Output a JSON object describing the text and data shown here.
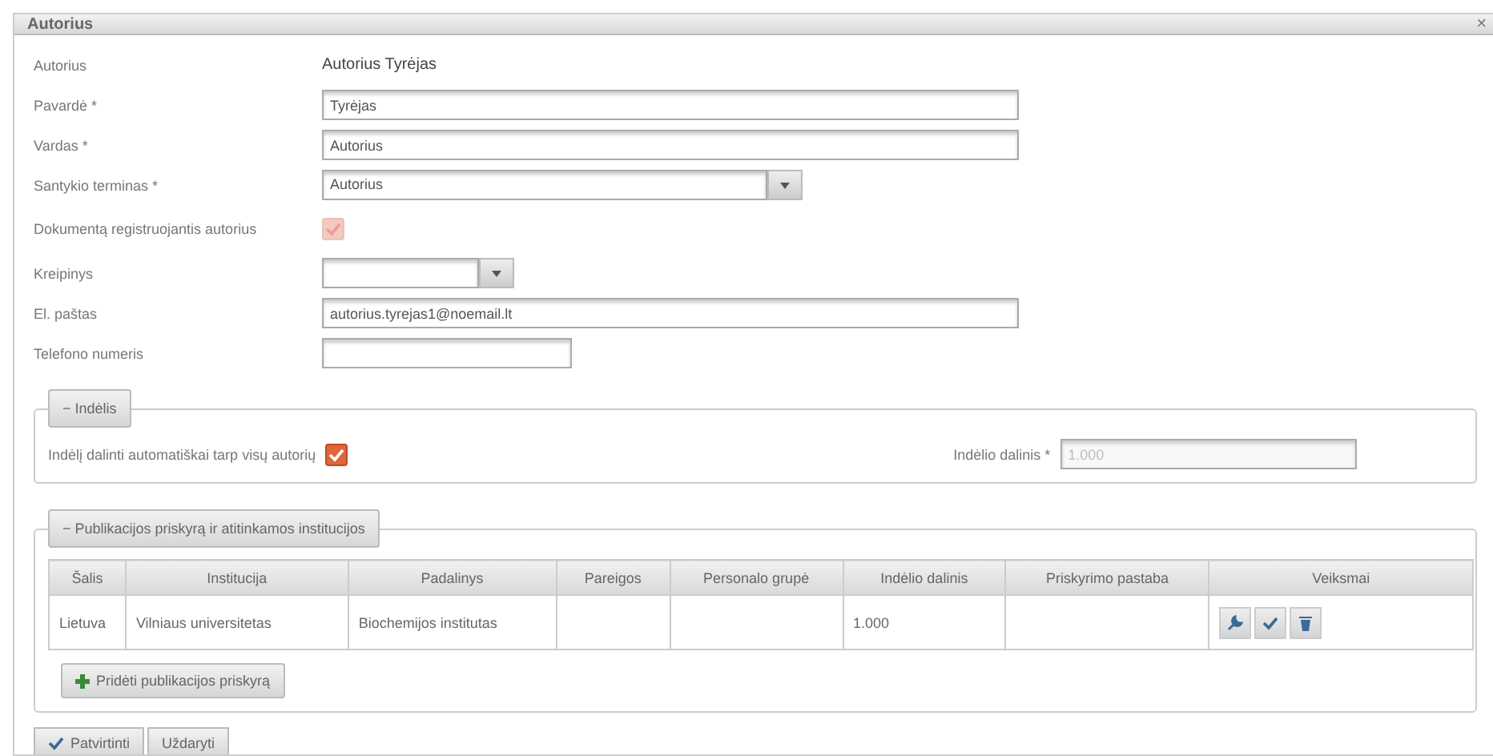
{
  "window": {
    "title": "Autorius",
    "close": "×"
  },
  "form": [
    {
      "kind": "text",
      "label": "Autorius",
      "value": "Autorius Tyrėjas"
    },
    {
      "kind": "input",
      "label": "Pavardė *",
      "value": "Tyrėjas"
    },
    {
      "kind": "input",
      "label": "Vardas *",
      "value": "Autorius"
    },
    {
      "kind": "select",
      "label": "Santykio terminas *",
      "value": "Autorius"
    },
    {
      "kind": "checkbox",
      "label": "Dokumentą registruojantis autorius",
      "checked": true,
      "disabled": true
    },
    {
      "kind": "select",
      "label": "Kreipinys"
    },
    {
      "kind": "input",
      "label": "El. paštas",
      "value": "autorius.tyrejas1@noemail.lt"
    },
    {
      "kind": "input",
      "label": "Telefono numeris"
    }
  ],
  "contribution": {
    "legend": "Indėlis",
    "toggle": "−",
    "auto_label": "Indėlį dalinti automatiškai tarp visų autorių",
    "auto_checked": true,
    "share_label": "Indėlio dalinis *",
    "share_value": "1.000",
    "share_disabled": true
  },
  "assignments": {
    "legend": "Publikacijos priskyrą ir atitinkamos institucijos",
    "toggle": "−",
    "columns": [
      "Šalis",
      "Institucija",
      "Padalinys",
      "Pareigos",
      "Personalo grupė",
      "Indėlio dalinis",
      "Priskyrimo pastaba",
      "Veiksmai"
    ],
    "rows": [
      {
        "cells": [
          "Lietuva",
          "Vilniaus universitetas",
          "Biochemijos institutas",
          "",
          "",
          "1.000",
          ""
        ]
      }
    ],
    "add_button": "Pridėti publikacijos priskyrą"
  },
  "buttons": [
    {
      "label": "Patvirtinti",
      "kind": "confirm"
    },
    {
      "label": "Uždaryti",
      "kind": "plain"
    }
  ]
}
